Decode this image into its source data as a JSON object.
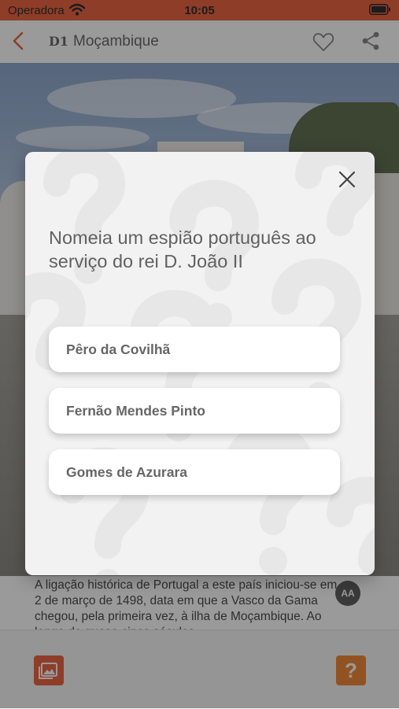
{
  "status_bar": {
    "carrier": "Operadora",
    "time": "10:05"
  },
  "nav": {
    "title_prefix": "D1",
    "title": "Moçambique"
  },
  "article": {
    "text": "A ligação histórica de Portugal a este país iniciou-se em 2 de março de 1498, data em que a Vasco da Gama chegou, pela primeira vez, à ilha de Moçambique. Ao longo de quase cinco séculos"
  },
  "text_size_button": "AA",
  "quiz_button": "?",
  "quiz": {
    "question": "Nomeia um espião português ao serviço do rei D. João II",
    "answers": [
      {
        "label": "Pêro da Covilhã"
      },
      {
        "label": "Fernão Mendes Pinto"
      },
      {
        "label": "Gomes de Azurara"
      }
    ]
  },
  "colors": {
    "accent": "#e8502a",
    "quiz_accent": "#f07a1e",
    "modal_background": "#f2f2f2",
    "answer_background": "#ffffff"
  },
  "icons": [
    "wifi-icon",
    "battery-icon",
    "back-chevron-icon",
    "heart-icon",
    "share-icon",
    "gallery-icon",
    "question-icon",
    "close-icon"
  ]
}
